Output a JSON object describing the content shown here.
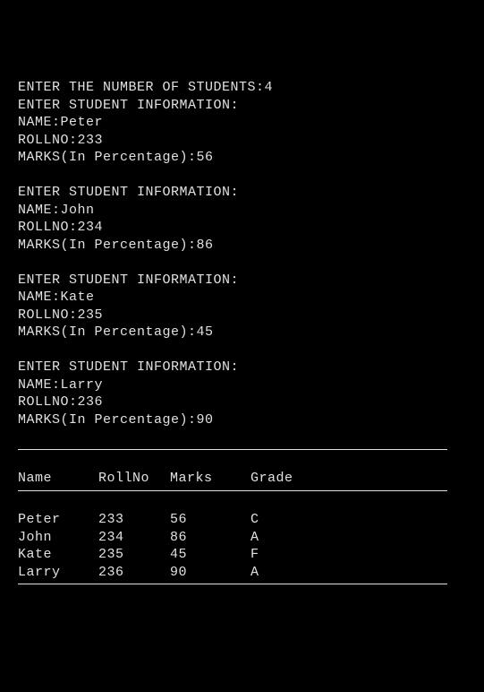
{
  "prompt": {
    "num_students_label": "ENTER THE NUMBER OF STUDENTS:",
    "num_students_value": "4",
    "info_label": "ENTER STUDENT INFORMATION:",
    "name_label": "NAME:",
    "rollno_label": "ROLLNO:",
    "marks_label": "MARKS(In Percentage):"
  },
  "students": [
    {
      "name": "Peter",
      "rollno": "233",
      "marks": "56",
      "grade": "C"
    },
    {
      "name": "John",
      "rollno": "234",
      "marks": "86",
      "grade": "A"
    },
    {
      "name": "Kate",
      "rollno": "235",
      "marks": "45",
      "grade": "F"
    },
    {
      "name": "Larry",
      "rollno": "236",
      "marks": "90",
      "grade": "A"
    }
  ],
  "table": {
    "headers": {
      "name": "Name",
      "rollno": "RollNo",
      "marks": "Marks",
      "grade": "Grade"
    }
  }
}
